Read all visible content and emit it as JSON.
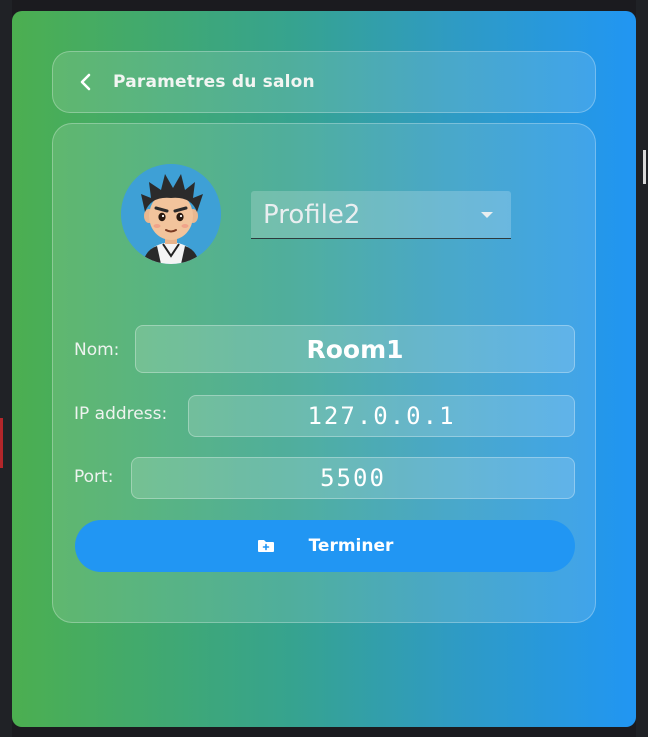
{
  "header": {
    "title": "Parametres du salon",
    "back_icon": "chevron-left-icon"
  },
  "profile": {
    "avatar": "cartoon-boy-avatar",
    "selected": "Profile2"
  },
  "form": {
    "name_label": "Nom:",
    "name_value": "Room1",
    "ip_label": "IP address:",
    "ip_value": "127.0.0.1",
    "port_label": "Port:",
    "port_value": "5500"
  },
  "submit": {
    "label": "Terminer",
    "icon": "folder-plus-icon"
  },
  "colors": {
    "gradient_start": "#4caf50",
    "gradient_end": "#2196f3",
    "button": "#2196f3"
  }
}
